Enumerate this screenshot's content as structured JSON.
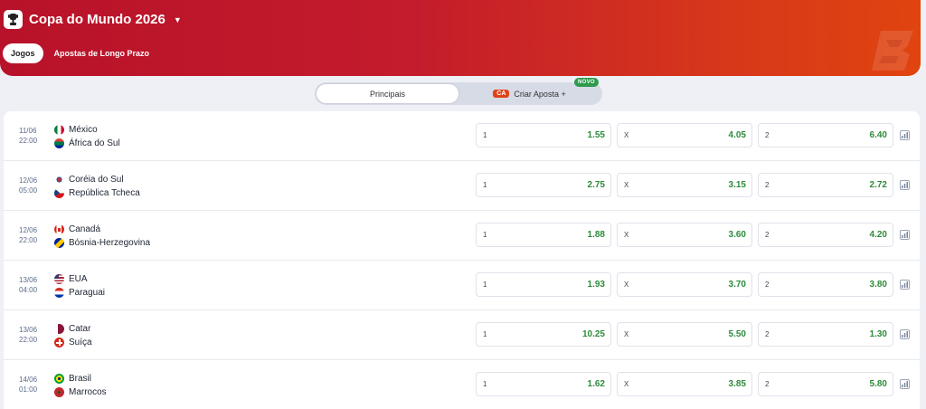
{
  "header": {
    "title": "Copa do Mundo 2026",
    "trophy_icon": "trophy-icon",
    "caret_icon": "caret-down-icon",
    "tabs": [
      {
        "label": "Jogos",
        "active": true
      },
      {
        "label": "Apostas de Longo Prazo",
        "active": false
      }
    ]
  },
  "segment": {
    "principais": "Principais",
    "criar_tag": "CA",
    "criar_label": "Criar Aposta +",
    "novo_badge": "NOVO"
  },
  "colors": {
    "header_start": "#b8122a",
    "header_end": "#e0440f",
    "odd_value": "#2e8b3b",
    "novo_badge": "#2e9a4c"
  },
  "matches": [
    {
      "date": "11/06",
      "time": "22:00",
      "home": "México",
      "away": "África do Sul",
      "home_flag": "mexico-flag-icon",
      "away_flag": "south-africa-flag-icon",
      "odds": [
        {
          "label": "1",
          "value": "1.55"
        },
        {
          "label": "X",
          "value": "4.05"
        },
        {
          "label": "2",
          "value": "6.40"
        }
      ]
    },
    {
      "date": "12/06",
      "time": "05:00",
      "home": "Coréia do Sul",
      "away": "República Tcheca",
      "home_flag": "south-korea-flag-icon",
      "away_flag": "czech-republic-flag-icon",
      "odds": [
        {
          "label": "1",
          "value": "2.75"
        },
        {
          "label": "X",
          "value": "3.15"
        },
        {
          "label": "2",
          "value": "2.72"
        }
      ]
    },
    {
      "date": "12/06",
      "time": "22:00",
      "home": "Canadá",
      "away": "Bósnia-Herzegovina",
      "home_flag": "canada-flag-icon",
      "away_flag": "bosnia-flag-icon",
      "odds": [
        {
          "label": "1",
          "value": "1.88"
        },
        {
          "label": "X",
          "value": "3.60"
        },
        {
          "label": "2",
          "value": "4.20"
        }
      ]
    },
    {
      "date": "13/06",
      "time": "04:00",
      "home": "EUA",
      "away": "Paraguai",
      "home_flag": "usa-flag-icon",
      "away_flag": "paraguay-flag-icon",
      "odds": [
        {
          "label": "1",
          "value": "1.93"
        },
        {
          "label": "X",
          "value": "3.70"
        },
        {
          "label": "2",
          "value": "3.80"
        }
      ]
    },
    {
      "date": "13/06",
      "time": "22:00",
      "home": "Catar",
      "away": "Suíça",
      "home_flag": "qatar-flag-icon",
      "away_flag": "switzerland-flag-icon",
      "odds": [
        {
          "label": "1",
          "value": "10.25"
        },
        {
          "label": "X",
          "value": "5.50"
        },
        {
          "label": "2",
          "value": "1.30"
        }
      ]
    },
    {
      "date": "14/06",
      "time": "01:00",
      "home": "Brasil",
      "away": "Marrocos",
      "home_flag": "brazil-flag-icon",
      "away_flag": "morocco-flag-icon",
      "odds": [
        {
          "label": "1",
          "value": "1.62"
        },
        {
          "label": "X",
          "value": "3.85"
        },
        {
          "label": "2",
          "value": "5.80"
        }
      ]
    }
  ]
}
